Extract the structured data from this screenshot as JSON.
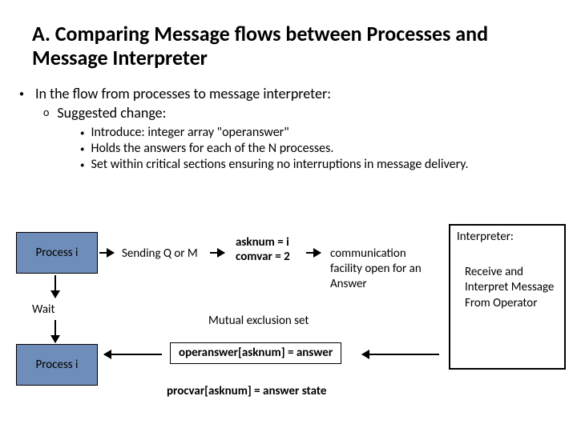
{
  "title": "A. Comparing Message flows between Processes and Message Interpreter",
  "bullet1": "In the flow from processes to message interpreter:",
  "bullet2": "Suggested change:",
  "sub": {
    "a": "Introduce:    integer array \"operanswer\"",
    "b": " Holds the answers for each of the N processes.",
    "c": " Set within critical sections ensuring no interruptions in message delivery."
  },
  "boxes": {
    "proc_top": "Process i",
    "proc_bottom": "Process i",
    "wait": "Wait",
    "sending": "Sending Q or M",
    "assign1": "asknum = i",
    "assign2": "comvar = 2",
    "comm_open": "communication facility open for an Answer",
    "mutex": "Mutual exclusion set",
    "operanswer": "operanswer[asknum] = answer",
    "procvar": "procvar[asknum] = answer state",
    "interp_title": "Interpreter:",
    "interp_body": "Receive and Interpret Message From Operator"
  }
}
